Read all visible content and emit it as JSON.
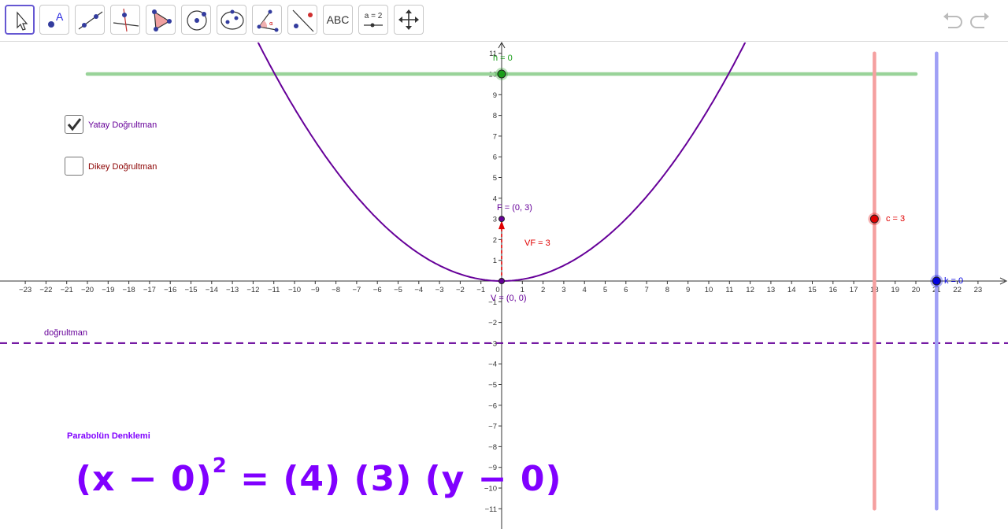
{
  "toolbar": {
    "tools": [
      {
        "name": "move-tool-button",
        "icon": "cursor-arrow-icon"
      },
      {
        "name": "point-tool-button",
        "icon": "point-icon"
      },
      {
        "name": "line-tool-button",
        "icon": "line-icon"
      },
      {
        "name": "perpendicular-tool-button",
        "icon": "perpendicular-line-icon"
      },
      {
        "name": "polygon-tool-button",
        "icon": "polygon-icon"
      },
      {
        "name": "circle-tool-button",
        "icon": "circle-icon"
      },
      {
        "name": "conic-tool-button",
        "icon": "ellipse-icon"
      },
      {
        "name": "angle-tool-button",
        "icon": "angle-icon"
      },
      {
        "name": "reflect-tool-button",
        "icon": "reflect-icon"
      },
      {
        "name": "text-tool-button",
        "icon": "text-icon",
        "label": "ABC"
      },
      {
        "name": "slider-tool-button",
        "icon": "slider-icon",
        "label": "a = 2"
      },
      {
        "name": "move-view-tool-button",
        "icon": "move-arrows-icon"
      }
    ],
    "undo_icon": "undo-icon",
    "redo_icon": "redo-icon"
  },
  "checkboxes": {
    "horizontal": {
      "label": "Yatay Doğrultman",
      "checked": true
    },
    "vertical": {
      "label": "Dikey Doğrultman",
      "checked": false
    }
  },
  "labels": {
    "h": "h = 0",
    "focus": "F = (0, 3)",
    "vf": "VF = 3",
    "vertex": "V = (0, 0)",
    "c": "c = 3",
    "k": "k = 0",
    "directrix": "doğrultman",
    "equation_title": "Parabolün Denklemi"
  },
  "equation": {
    "lhs": "(x − 0)",
    "exp": "2",
    "rhs": "= (4) (3) (y − 0)"
  },
  "colors": {
    "parabola": "#660099",
    "directrix": "#660099",
    "h_slider": "#99d399",
    "h_point": "#1a9e1a",
    "c_slider": "#f5a0a0",
    "c_point": "#e00000",
    "k_slider": "#a0a0f5",
    "k_point": "#0000e0",
    "vf_vector": "#e00000",
    "equation": "#8000ff"
  },
  "chart_data": {
    "type": "line",
    "x_range": [
      -24,
      24
    ],
    "y_range": [
      -11,
      11
    ],
    "x_ticks": [
      -23,
      -22,
      -21,
      -20,
      -19,
      -18,
      -17,
      -16,
      -15,
      -14,
      -13,
      -12,
      -11,
      -10,
      -9,
      -8,
      -7,
      -6,
      -5,
      -4,
      -3,
      -2,
      -1,
      0,
      1,
      2,
      3,
      4,
      5,
      6,
      7,
      8,
      9,
      10,
      11,
      12,
      13,
      14,
      15,
      16,
      17,
      18,
      19,
      20,
      21,
      22,
      23
    ],
    "y_ticks": [
      -11,
      -10,
      -9,
      -8,
      -7,
      -6,
      -5,
      -4,
      -3,
      -2,
      -1,
      0,
      1,
      2,
      3,
      4,
      5,
      6,
      7,
      8,
      9,
      10,
      11
    ],
    "parabola": {
      "h": 0,
      "k": 0,
      "c": 3
    },
    "focus": [
      0,
      3
    ],
    "vertex": [
      0,
      0
    ],
    "directrix_y": -3,
    "h_slider": {
      "y": 10,
      "x_range": [
        -20,
        20
      ],
      "value": 0
    },
    "c_slider": {
      "x": 18,
      "y_range": [
        -11,
        11
      ],
      "value": 3
    },
    "k_slider": {
      "x": 21,
      "y_range": [
        -11,
        11
      ],
      "value": 0
    }
  }
}
